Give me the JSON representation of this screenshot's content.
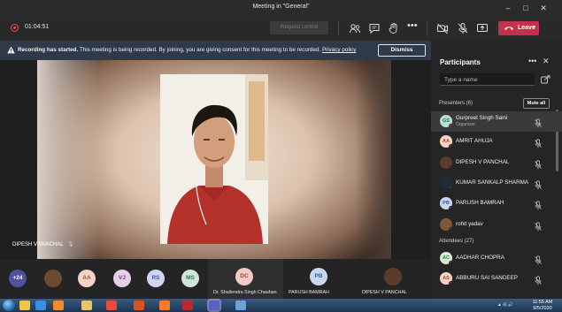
{
  "window": {
    "title": "Meeting in \"General\"",
    "minimize": "–",
    "maximize": "□",
    "close": "✕"
  },
  "toolbar": {
    "timer": "01:04:51",
    "request_control": "Request control",
    "leave_label": "Leave",
    "icons": [
      "participants-icon",
      "chat-icon",
      "raise-hand-icon",
      "more-icon",
      "video-off-icon",
      "mic-off-icon",
      "share-screen-icon"
    ]
  },
  "banner": {
    "bold": "Recording has started.",
    "text": " This meeting is being recorded. By joining, you are giving consent for this meeting to be recorded. ",
    "link": "Privacy policy",
    "dismiss": "Dismiss"
  },
  "stage": {
    "speaker_name": "DIPESH V PANCHAL"
  },
  "participants_panel": {
    "title": "Participants",
    "search_placeholder": "Type a name",
    "presenters_label": "Presenters (6)",
    "mute_all": "Mute all",
    "attendees_label": "Attendees (27)",
    "presenters": [
      {
        "initials": "GS",
        "name": "Gurpreet Singh Saini",
        "role": "Organizer",
        "color": "#b8e0d0",
        "text": "#2a6b52"
      },
      {
        "initials": "AA",
        "name": "AMRIT AHUJA",
        "role": "",
        "color": "#f3d3c8",
        "text": "#a9472b"
      },
      {
        "initials": "",
        "name": "DIPESH V PANCHAL",
        "role": "",
        "color": "#5a3b2c",
        "text": "#fff"
      },
      {
        "initials": "",
        "name": "KUMAR SANKALP SHARMA",
        "role": "",
        "color": "#1e2b3a",
        "text": "#fff"
      },
      {
        "initials": "PB",
        "name": "PARUSH BAMRAH",
        "role": "",
        "color": "#c9d7ee",
        "text": "#3a5aa5"
      },
      {
        "initials": "",
        "name": "rohit yadav",
        "role": "",
        "color": "#7a5a3c",
        "text": "#fff"
      }
    ],
    "attendees": [
      {
        "initials": "AC",
        "name": "AADHAR CHOPRA",
        "role": "",
        "color": "#d4ecd6",
        "text": "#2f7a3d"
      },
      {
        "initials": "AS",
        "name": "ABBURU SAI SANDEEP",
        "role": "",
        "color": "#f3d3c8",
        "text": "#a9472b"
      }
    ]
  },
  "strip": {
    "overflow": "+24",
    "avatars": [
      {
        "initials": "",
        "color": "#6b4a32",
        "text": "#fff"
      },
      {
        "initials": "AA",
        "color": "#f3d3c8",
        "text": "#a9472b"
      },
      {
        "initials": "VJ",
        "color": "#e7cfe9",
        "text": "#7d3a86"
      },
      {
        "initials": "RS",
        "color": "#d3d5f0",
        "text": "#4a4fa8"
      },
      {
        "initials": "MS",
        "color": "#cfe7d8",
        "text": "#2f7a4a"
      }
    ],
    "tiles": [
      {
        "initials": "DC",
        "name": "Dr. Shailendra Singh Chauhan",
        "color": "#f1c9c5",
        "text": "#a8443b"
      },
      {
        "initials": "PB",
        "name": "PARUSH BAMRAH",
        "color": "#c9d7ee",
        "text": "#3a5aa5"
      },
      {
        "initials": "",
        "name": "DIPESH V PANCHAL",
        "color": "#5a3b2c",
        "text": "#fff"
      }
    ]
  },
  "taskbar": {
    "time": "11:55 AM",
    "date": "9/5/2020",
    "tray": "▲ ⊟ 🔊",
    "apps": [
      "explorer-icon",
      "ie-icon",
      "media-icon",
      "folder-icon",
      "chrome-icon",
      "matlab-icon",
      "firefox-icon",
      "acrobat-icon",
      "teams-icon",
      "paint-icon"
    ]
  },
  "colors": {
    "accent": "#6264a7",
    "leave": "#c4314b",
    "banner": "#2e3a4a"
  }
}
